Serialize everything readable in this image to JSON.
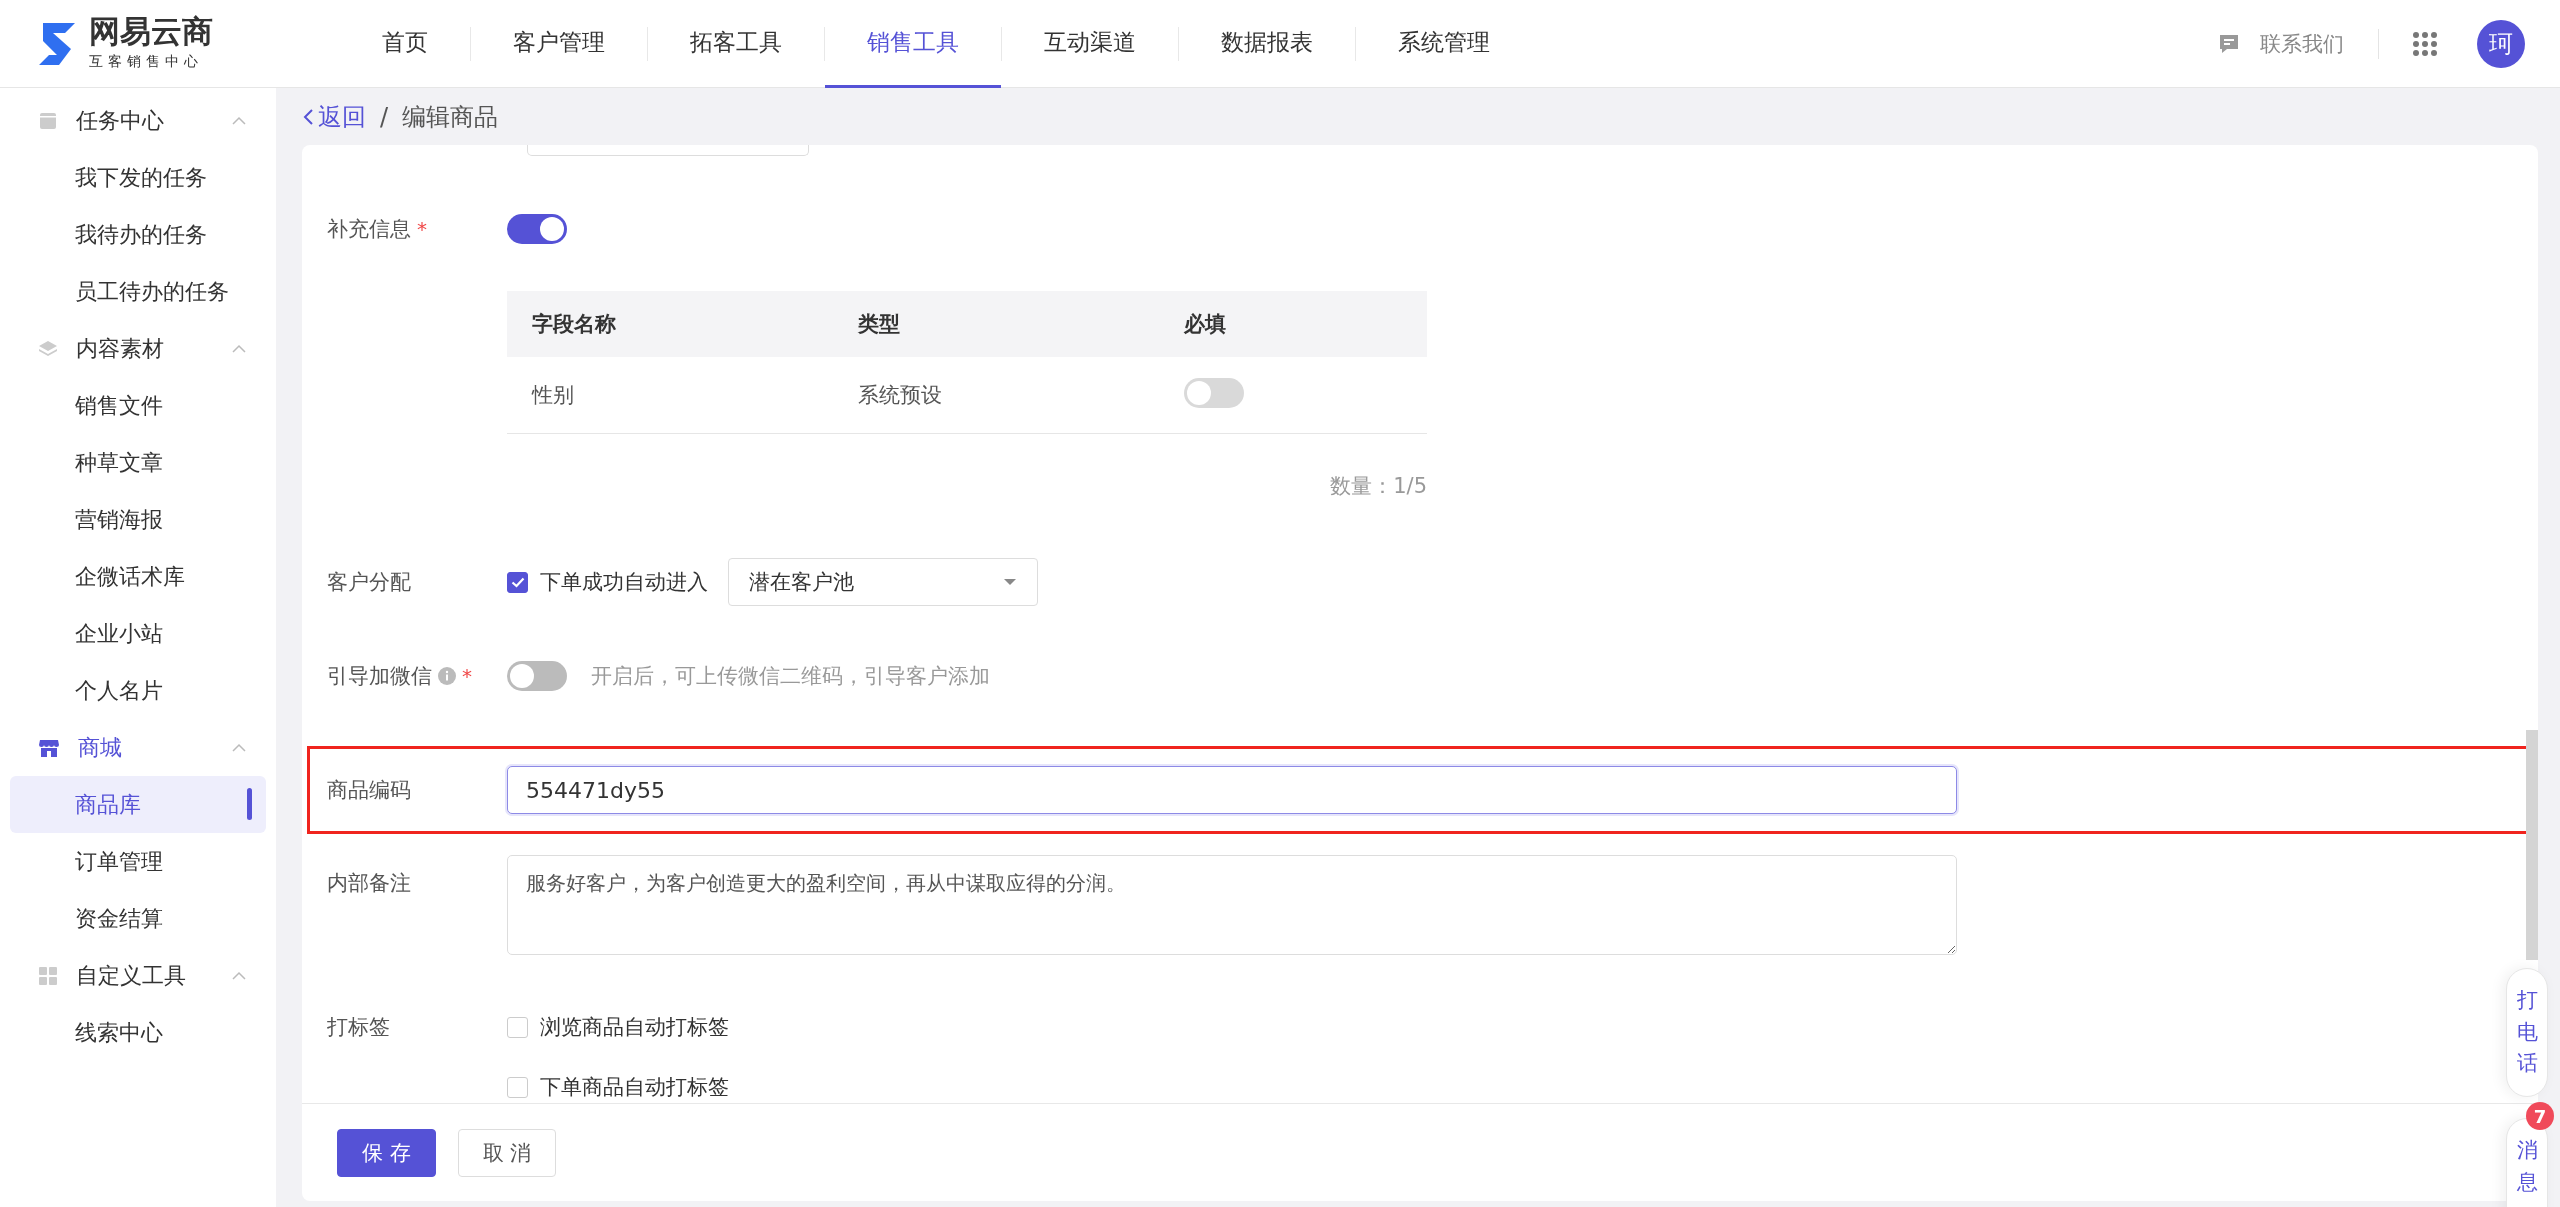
{
  "brand": {
    "name": "网易云商",
    "tagline": "互客销售中心"
  },
  "nav": [
    {
      "label": "首页",
      "selected": false
    },
    {
      "label": "客户管理",
      "selected": false
    },
    {
      "label": "拓客工具",
      "selected": false
    },
    {
      "label": "销售工具",
      "selected": true
    },
    {
      "label": "互动渠道",
      "selected": false
    },
    {
      "label": "数据报表",
      "selected": false
    },
    {
      "label": "系统管理",
      "selected": false
    }
  ],
  "header": {
    "contact": "联系我们",
    "avatar": "珂"
  },
  "sidebar": [
    {
      "label": "任务中心",
      "expanded": true,
      "selected": false,
      "children": [
        {
          "label": "我下发的任务",
          "selected": false
        },
        {
          "label": "我待办的任务",
          "selected": false
        },
        {
          "label": "员工待办的任务",
          "selected": false
        }
      ]
    },
    {
      "label": "内容素材",
      "expanded": true,
      "selected": false,
      "children": [
        {
          "label": "销售文件",
          "selected": false
        },
        {
          "label": "种草文章",
          "selected": false
        },
        {
          "label": "营销海报",
          "selected": false
        },
        {
          "label": "企微话术库",
          "selected": false
        },
        {
          "label": "企业小站",
          "selected": false
        },
        {
          "label": "个人名片",
          "selected": false
        }
      ]
    },
    {
      "label": "商城",
      "expanded": true,
      "selected": true,
      "children": [
        {
          "label": "商品库",
          "selected": true
        },
        {
          "label": "订单管理",
          "selected": false
        },
        {
          "label": "资金结算",
          "selected": false
        }
      ]
    },
    {
      "label": "自定义工具",
      "expanded": true,
      "selected": false,
      "children": [
        {
          "label": "线索中心",
          "selected": false
        }
      ]
    }
  ],
  "breadcrumb": {
    "back": "返回",
    "separator": "/",
    "current": "编辑商品"
  },
  "form": {
    "supplement": {
      "label": "补充信息",
      "required_mark": "*",
      "on": true,
      "columns": [
        "字段名称",
        "类型",
        "必填"
      ],
      "rows": [
        {
          "name": "性别",
          "type": "系统预设",
          "required_on": false
        }
      ],
      "count": "数量：1/5"
    },
    "assign": {
      "label": "客户分配",
      "checked": true,
      "option": "下单成功自动进入",
      "select": "潜在客户池"
    },
    "wechat": {
      "label": "引导加微信",
      "required_mark": "*",
      "on": false,
      "hint": "开启后，可上传微信二维码，引导客户添加"
    },
    "code": {
      "label": "商品编码",
      "value": "554471dy55",
      "highlighted": true
    },
    "note": {
      "label": "内部备注",
      "value": "服务好客户，为客户创造更大的盈利空间，再从中谋取应得的分润。"
    },
    "tags": {
      "label": "打标签",
      "options": [
        {
          "label": "浏览商品自动打标签",
          "checked": false
        },
        {
          "label": "下单商品自动打标签",
          "checked": false
        }
      ]
    }
  },
  "footer": {
    "save": "保 存",
    "cancel": "取 消"
  },
  "float": {
    "call": "打电话",
    "messages": "消息",
    "badge": "7"
  }
}
